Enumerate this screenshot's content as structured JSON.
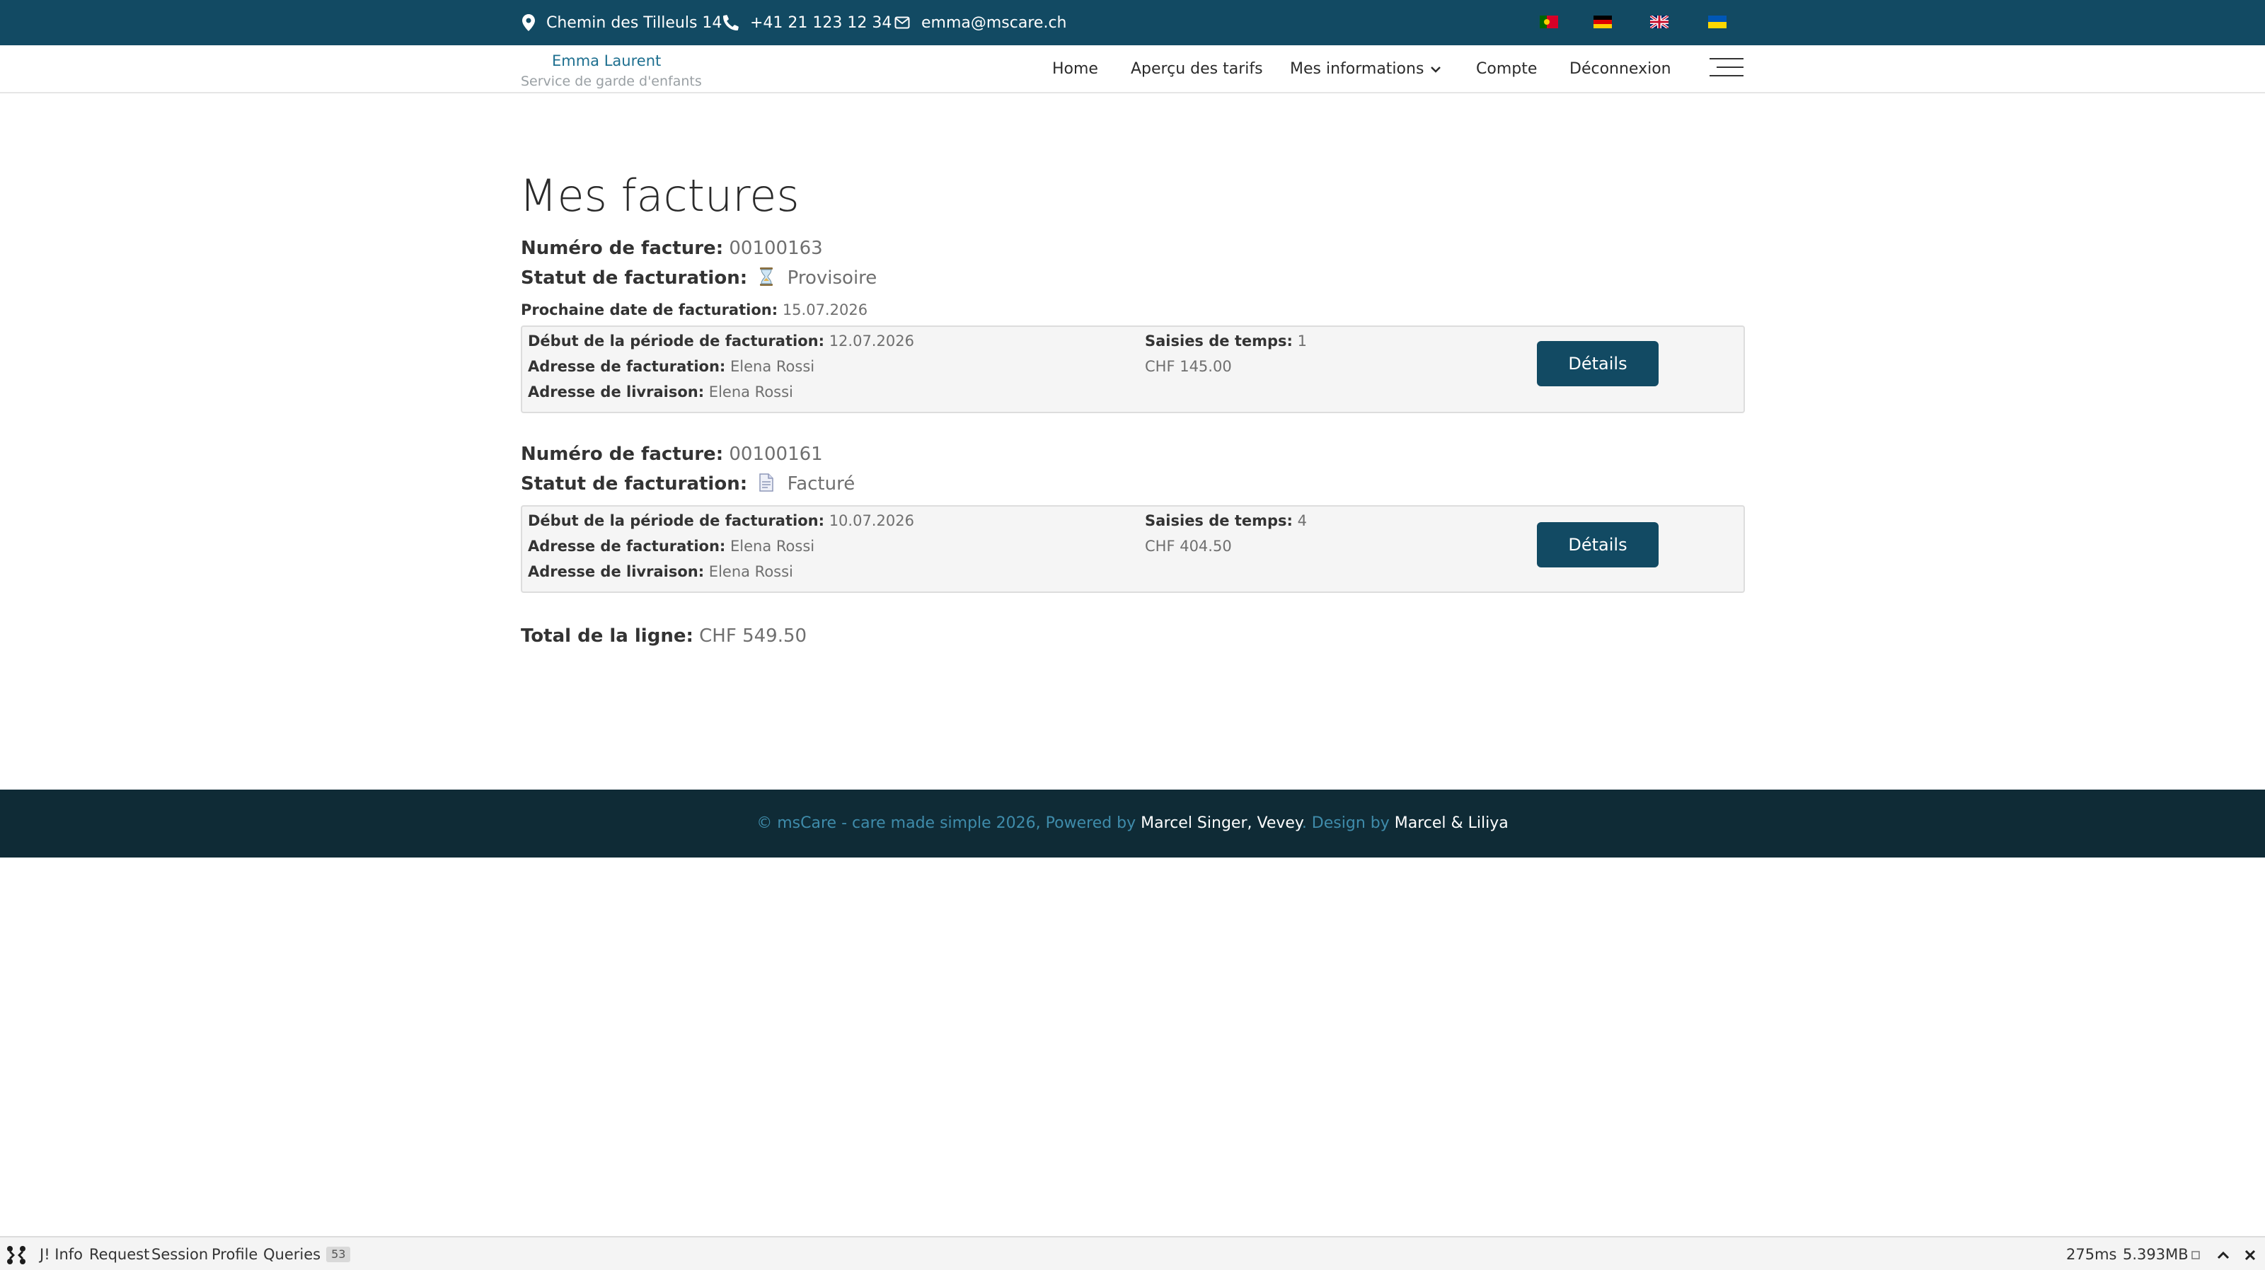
{
  "topbar": {
    "address": "Chemin des Tilleuls 14",
    "phone": "+41 21 123 12 34",
    "email": "emma@mscare.ch",
    "flags": [
      "portugal-flag-icon",
      "germany-flag-icon",
      "uk-flag-icon",
      "ukraine-flag-icon"
    ],
    "color": "#124a63"
  },
  "brand": {
    "name": "Emma Laurent",
    "subtitle": "Service de garde d'enfants"
  },
  "nav": {
    "items": [
      "Home",
      "Aperçu des tarifs",
      "Mes informations",
      "Compte",
      "Déconnexion"
    ]
  },
  "page": {
    "title": "Mes factures"
  },
  "labels": {
    "invoice_number": "Numéro de facture:",
    "billing_status": "Statut de facturation:",
    "next_billing_date": "Prochaine date de facturation:",
    "period_start": "Début de la période de facturation:",
    "billing_address": "Adresse de facturation:",
    "delivery_address": "Adresse de livraison:",
    "time_entries": "Saisies de temps:",
    "details_button": "Détails",
    "line_total": "Total de la ligne:"
  },
  "invoices": [
    {
      "number": "00100163",
      "status": "Provisoire",
      "status_icon": "hourglass-icon",
      "next_billing_date": "15.07.2026",
      "period_start": "12.07.2026",
      "billing_address": "Elena Rossi",
      "delivery_address": "Elena Rossi",
      "time_entries": "1",
      "amount": "CHF 145.00"
    },
    {
      "number": "00100161",
      "status": "Facturé",
      "status_icon": "document-icon",
      "period_start": "10.07.2026",
      "billing_address": "Elena Rossi",
      "delivery_address": "Elena Rossi",
      "time_entries": "4",
      "amount": "CHF 404.50"
    }
  ],
  "total": {
    "value": "CHF 549.50"
  },
  "footer": {
    "copyright": "© msCare - care made simple 2026, Powered by",
    "powered_by": "Marcel Singer, Vevey",
    "design_label": ". Design by",
    "designers": "Marcel & Liliya",
    "background": "#0f2b36"
  },
  "debugbar": {
    "items": [
      "J! Info",
      "Request",
      "Session",
      "Profile",
      "Queries"
    ],
    "queries_count": "53",
    "time": "275ms",
    "memory": "5.393MB"
  }
}
